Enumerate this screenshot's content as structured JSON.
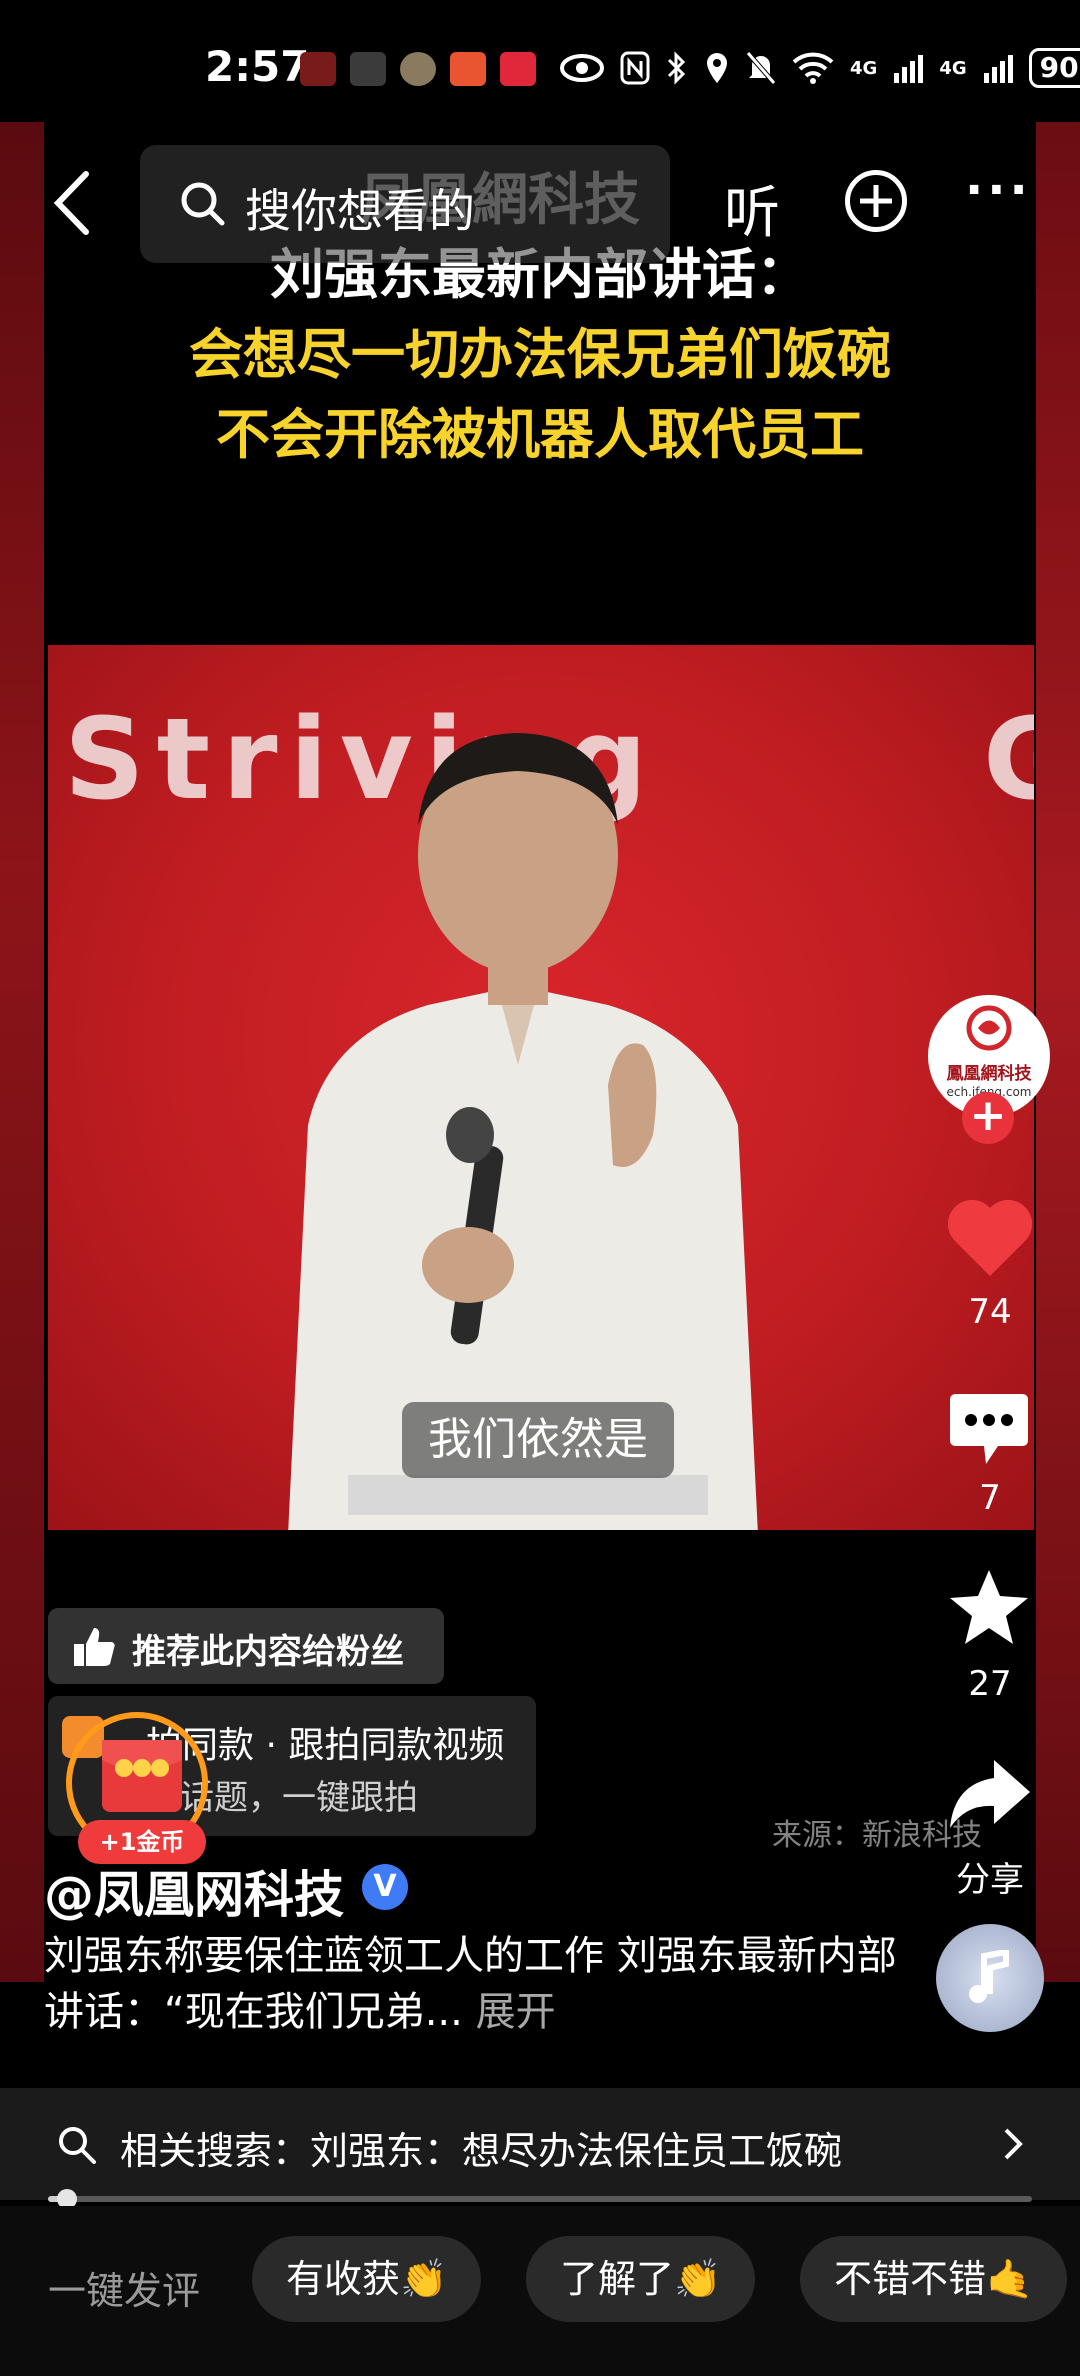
{
  "status_bar": {
    "time": "2:57",
    "network_1": "4G",
    "network_2": "4G",
    "battery": "90"
  },
  "top_bar": {
    "search_placeholder": "搜你想看的",
    "listen_label": "听"
  },
  "video": {
    "headline_line1": "刘强东最新内部讲话：",
    "headline_line2": "会想尽一切办法保兄弟们饭碗",
    "headline_line3": "不会开除被机器人取代员工",
    "backdrop_text": "Striving",
    "backdrop_text_2": "G",
    "subtitle": "我们依然是",
    "watermark": "凤凰網科技",
    "source": "来源：新浪科技"
  },
  "actions": {
    "avatar_text": "鳳凰網科技",
    "avatar_url_text": "ech.ifeng.com",
    "likes": "74",
    "comments": "7",
    "favorites": "27",
    "share_label": "分享"
  },
  "overlays": {
    "recommend_label": "推荐此内容给粉丝",
    "template_line1": "拍同款 · 跟拍同款视频",
    "template_line2": "同话题，一键跟拍",
    "coin_badge": "+1金币"
  },
  "post": {
    "author": "@凤凰网科技",
    "verified_mark": "V",
    "description": "刘强东称要保住蓝领工人的工作 刘强东最新内部讲话：“现在我们兄弟...",
    "expand_label": "展开"
  },
  "related_search": {
    "text": "相关搜索：刘强东：想尽办法保住员工饭碗"
  },
  "playback": {
    "progress": 0.015
  },
  "quick_comments": {
    "label": "一键发评",
    "chips": [
      "有收获👏",
      "了解了👏",
      "不错不错🤙"
    ]
  },
  "colors": {
    "accent_red": "#e8333d",
    "headline_yellow": "#f7d32c",
    "verified_blue": "#3e7bf4",
    "coin_orange": "#ff9a1a"
  }
}
